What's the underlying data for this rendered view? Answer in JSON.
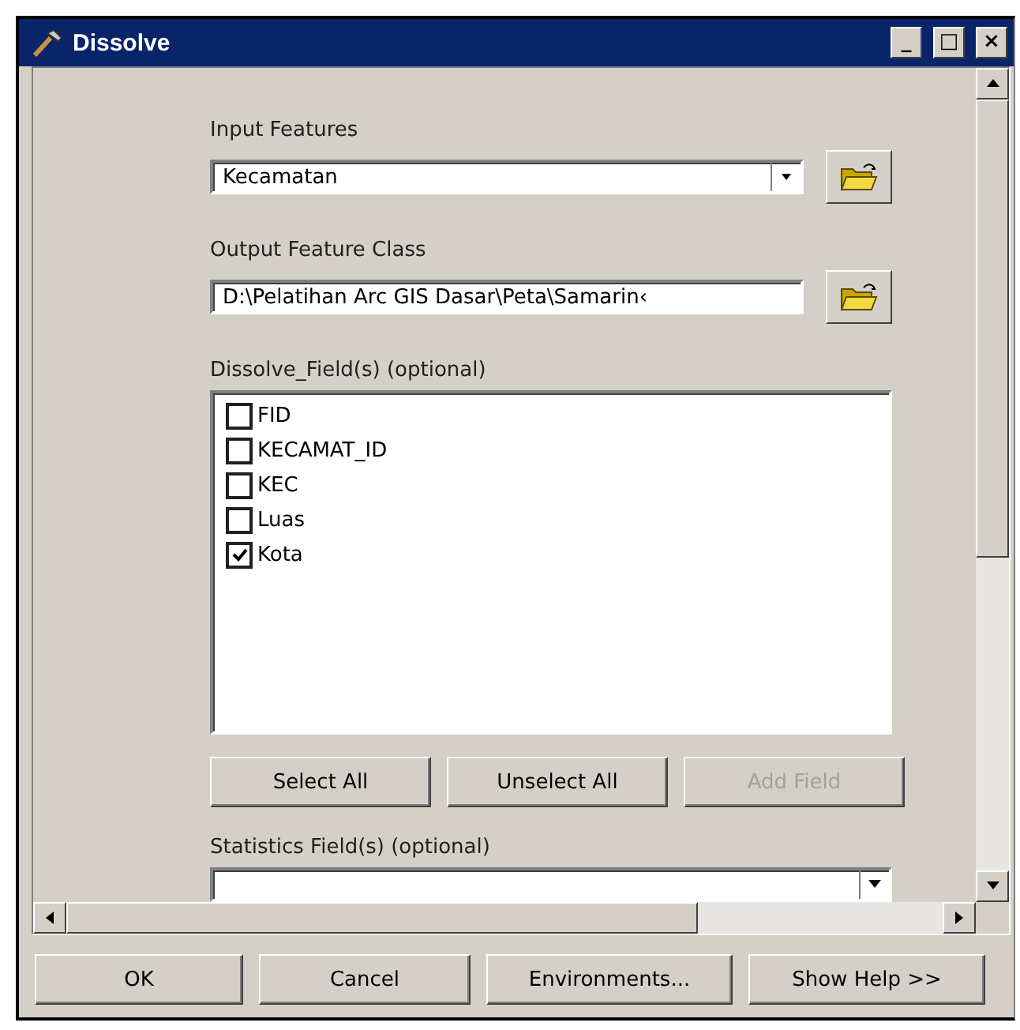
{
  "window": {
    "title": "Dissolve",
    "controls": [
      "_",
      "□",
      "×"
    ]
  },
  "input_features": {
    "label": "Input Features",
    "value": "Kecamatan"
  },
  "output_feature_class": {
    "label": "Output Feature Class",
    "value": "D:\\Pelatihan Arc GIS Dasar\\Peta\\Samarin‹"
  },
  "dissolve_fields": {
    "label": "Dissolve_Field(s) (optional)",
    "items": [
      {
        "label": "FID",
        "checked": false
      },
      {
        "label": "KECAMAT_ID",
        "checked": false
      },
      {
        "label": "KEC",
        "checked": false
      },
      {
        "label": "Luas",
        "checked": false
      },
      {
        "label": "Kota",
        "checked": true
      }
    ],
    "buttons": [
      {
        "label": "Select All",
        "disabled": false
      },
      {
        "label": "Unselect All",
        "disabled": false
      },
      {
        "label": "Add Field",
        "disabled": true
      }
    ]
  },
  "statistics_fields": {
    "label": "Statistics Field(s) (optional)"
  },
  "buttons": [
    "OK",
    "Cancel",
    "Environments...",
    "Show Help >>"
  ]
}
